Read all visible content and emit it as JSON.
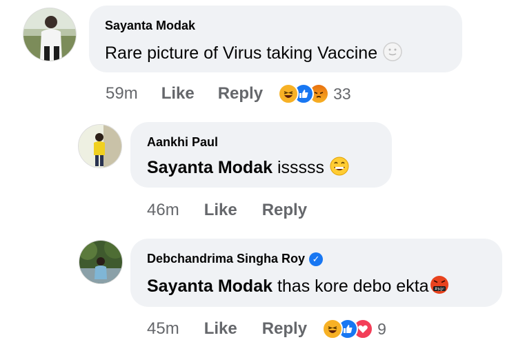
{
  "comments": [
    {
      "author": "Sayanta Modak",
      "text": "Rare picture of Virus taking Vaccine",
      "time": "59m",
      "like_label": "Like",
      "reply_label": "Reply",
      "reaction_count": "33",
      "reactions": [
        "haha-icon",
        "like-icon",
        "angry-icon"
      ],
      "trailing_emoji": "smiley-icon"
    },
    {
      "author": "Aankhi Paul",
      "mention": "Sayanta Modak",
      "text": " isssss",
      "time": "46m",
      "like_label": "Like",
      "reply_label": "Reply",
      "trailing_emoji": "grinning-face-icon"
    },
    {
      "author": "Debchandrima Singha Roy",
      "verified": true,
      "mention": "Sayanta Modak",
      "text": " thas kore debo ekta",
      "time": "45m",
      "like_label": "Like",
      "reply_label": "Reply",
      "reaction_count": "9",
      "reactions": [
        "haha-icon",
        "like-icon",
        "love-icon"
      ],
      "trailing_emoji": "cursing-face-icon"
    }
  ],
  "colors": {
    "bubble": "#f0f2f5",
    "meta_text": "#65676b",
    "like_blue": "#1877f2",
    "haha_yellow": "#f7b125",
    "angry_orange": "#e9710f",
    "love_red": "#f33e58"
  }
}
